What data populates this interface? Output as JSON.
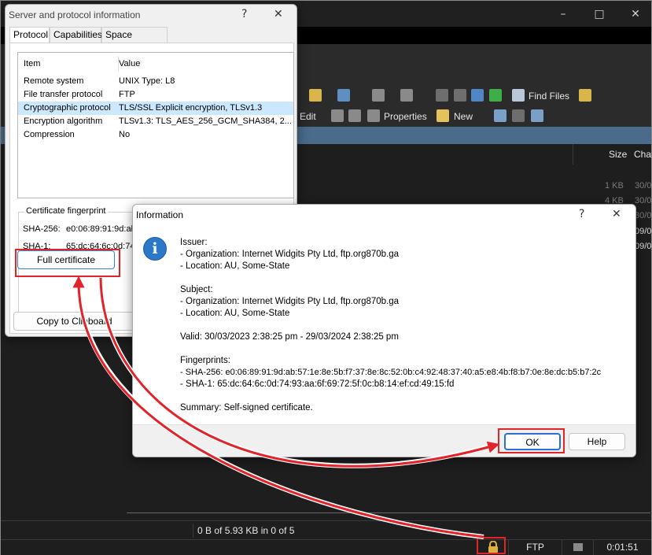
{
  "app": {
    "toolbar1": {
      "find_files": "Find Files"
    },
    "toolbar2": {
      "edit": "Edit",
      "properties": "Properties",
      "new": "New"
    },
    "columns": {
      "size": "Size",
      "changed": "Chan"
    },
    "cells": [
      "1 KB",
      "4 KB",
      "30/0",
      "30/0",
      "09/0",
      "30/0",
      "09/0"
    ],
    "status_text": "0 B of 5.93 KB in 0 of 5",
    "protocol": "FTP",
    "timer": "0:01:51"
  },
  "server_dialog": {
    "title": "Server and protocol information",
    "help": "?",
    "close": "✕",
    "tabs": [
      "Protocol",
      "Capabilities",
      "Space available"
    ],
    "list_headers": {
      "item": "Item",
      "value": "Value"
    },
    "rows": [
      {
        "item": "Remote system",
        "value": "UNIX Type: L8"
      },
      {
        "item": "File transfer protocol",
        "value": "FTP"
      },
      {
        "item": "Cryptographic protocol",
        "value": "TLS/SSL Explicit encryption, TLSv1.3"
      },
      {
        "item": "Encryption algorithm",
        "value": "TLSv1.3: TLS_AES_256_GCM_SHA384, 2..."
      },
      {
        "item": "Compression",
        "value": "No"
      }
    ],
    "fingerprint_group": "Certificate fingerprint",
    "sha256_label": "SHA-256:",
    "sha256_value": "e0:06:89:91:9d:ał",
    "sha1_label": "SHA-1:",
    "sha1_value": "65:dc:64:6c:0d:74",
    "full_certificate": "Full certificate",
    "copy_to_clipboard": "Copy to Clipboard"
  },
  "info_dialog": {
    "title": "Information",
    "help": "?",
    "close": "✕",
    "lines": [
      "Issuer:",
      "- Organization: Internet Widgits Pty Ltd, ftp.org870b.ga",
      "- Location: AU, Some-State",
      "Subject:",
      "- Organization: Internet Widgits Pty Ltd, ftp.org870b.ga",
      "- Location: AU, Some-State",
      "Valid: 30/03/2023 2:38:25 pm - 29/03/2024 2:38:25 pm",
      "Fingerprints:",
      "- SHA-256: e0:06:89:91:9d:ab:57:1e:8e:5b:f7:37:8e:8c:52:0b:c4:92:48:37:40:a5:e8:4b:f8:b7:0e:8e:dc:b5:b7:2c",
      "- SHA-1: 65:dc:64:6c:0d:74:93:aa:6f:69:72:5f:0c:b8:14:ef:cd:49:15:fd",
      "Summary: Self-signed certificate."
    ],
    "ok": "OK",
    "help_button": "Help"
  },
  "colors": {
    "highlight": "#e0242a",
    "info_icon": "#2c78c8",
    "selection": "#cce8ff"
  }
}
